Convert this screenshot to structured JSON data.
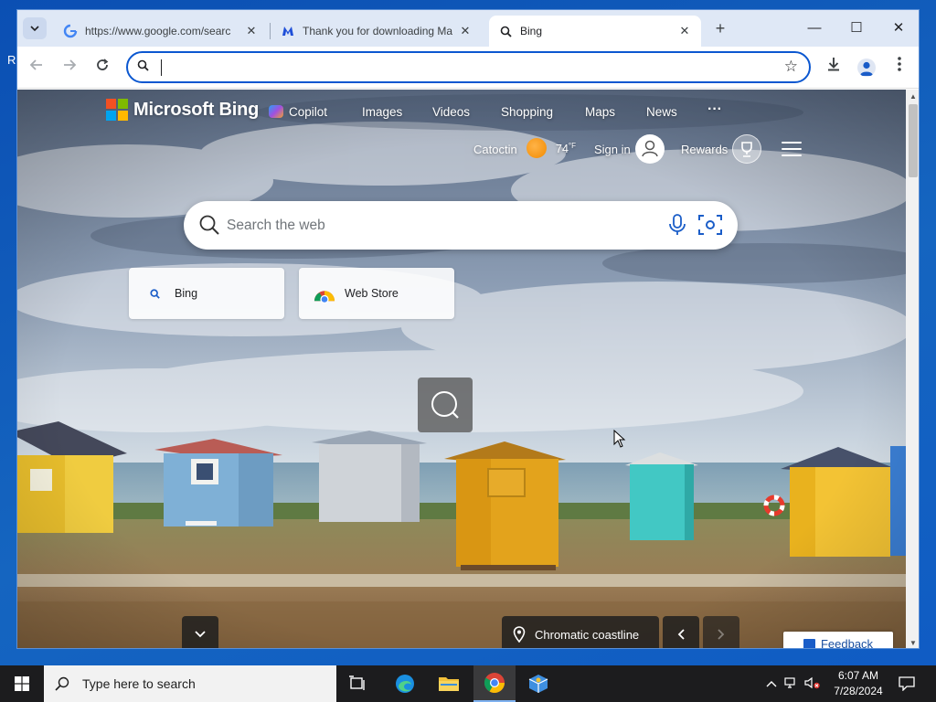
{
  "browser": {
    "tabs": [
      {
        "title": "https://www.google.com/searc",
        "favicon": "google-g-icon"
      },
      {
        "title": "Thank you for downloading Ma",
        "favicon": "malwarebytes-icon"
      },
      {
        "title": "Bing",
        "favicon": "search-icon",
        "active": true
      }
    ],
    "address": {
      "value": "",
      "placeholder": ""
    }
  },
  "bing": {
    "logo_text": "Microsoft Bing",
    "nav": [
      "Copilot",
      "Images",
      "Videos",
      "Shopping",
      "Maps",
      "News"
    ],
    "more": "···",
    "location": "Catoctin",
    "temperature": "74",
    "temp_unit": "°F",
    "sign_in": "Sign in",
    "rewards": "Rewards",
    "search_placeholder": "Search the web",
    "tiles": [
      {
        "label": "Bing",
        "icon": "search-icon"
      },
      {
        "label": "Web Store",
        "icon": "chrome-web-store-icon"
      }
    ],
    "image_caption": "Chromatic coastline",
    "feedback": "Feedback"
  },
  "taskbar": {
    "search_placeholder": "Type here to search",
    "time": "6:07 AM",
    "date": "7/28/2024"
  },
  "desktop": {
    "edge_glyph": "R"
  },
  "colors": {
    "omnibox_border": "#0b57d0",
    "taskbar": "#1c1c1e",
    "desktop": "#1565c0"
  }
}
